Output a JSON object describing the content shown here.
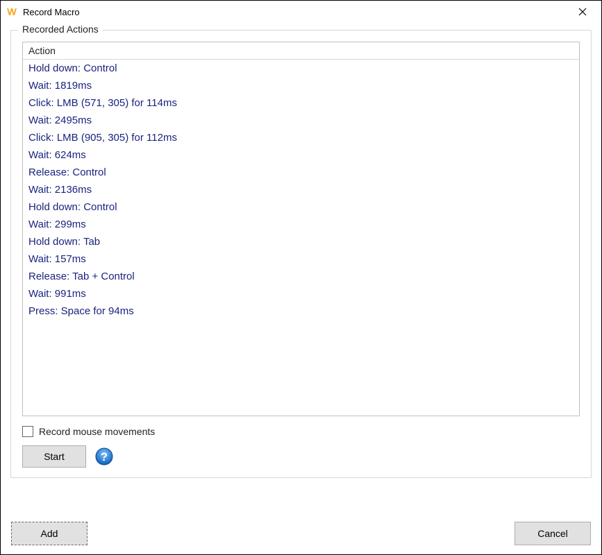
{
  "window": {
    "title": "Record Macro"
  },
  "group": {
    "label": "Recorded Actions",
    "column_header": "Action"
  },
  "actions": [
    {
      "text": "Hold down: Control"
    },
    {
      "text": "Wait: 1819ms"
    },
    {
      "text": "Click: LMB (571, 305) for 114ms"
    },
    {
      "text": "Wait: 2495ms"
    },
    {
      "text": "Click: LMB (905, 305) for 112ms"
    },
    {
      "text": "Wait: 624ms"
    },
    {
      "text": "Release: Control"
    },
    {
      "text": "Wait: 2136ms"
    },
    {
      "text": "Hold down: Control"
    },
    {
      "text": "Wait: 299ms"
    },
    {
      "text": "Hold down: Tab"
    },
    {
      "text": "Wait: 157ms"
    },
    {
      "text": "Release: Tab + Control"
    },
    {
      "text": "Wait: 991ms"
    },
    {
      "text": "Press: Space for 94ms"
    }
  ],
  "checkbox": {
    "label": "Record mouse movements",
    "checked": false
  },
  "buttons": {
    "start": "Start",
    "add": "Add",
    "cancel": "Cancel"
  }
}
